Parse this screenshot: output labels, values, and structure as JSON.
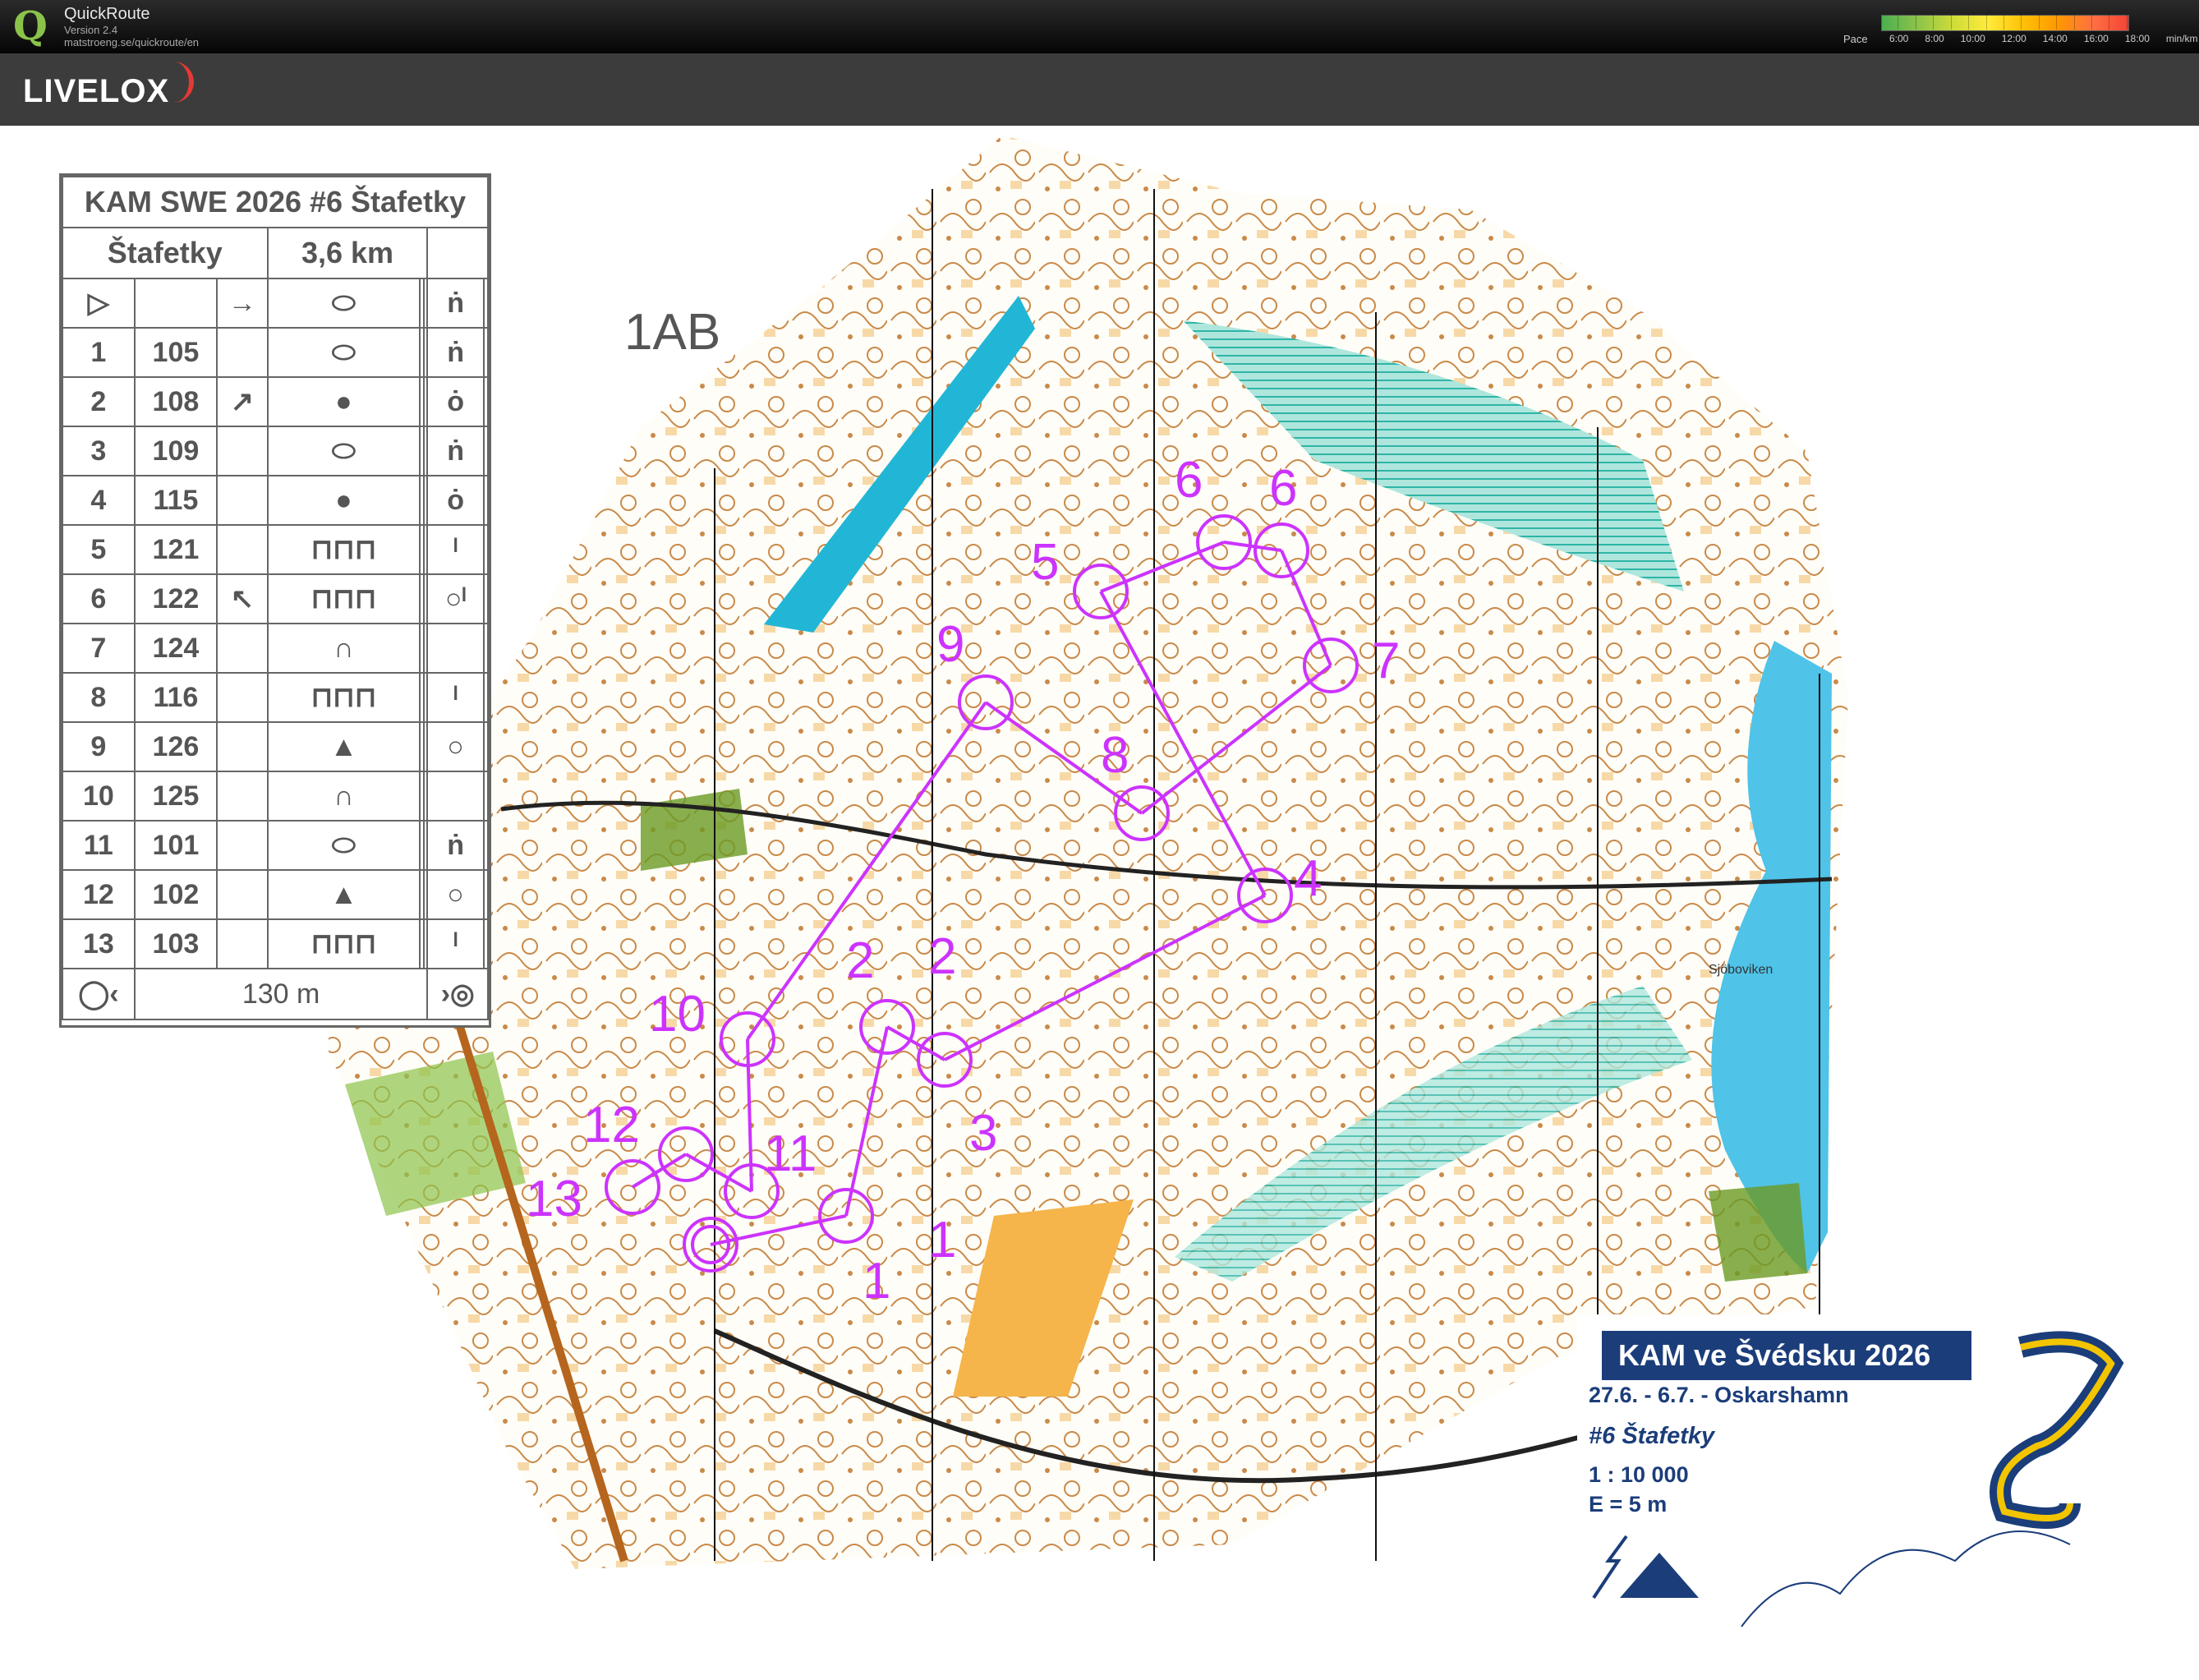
{
  "app": {
    "name": "QuickRoute",
    "version": "Version 2.4",
    "url": "matstroeng.se/quickroute/en",
    "logo_letter": "Q"
  },
  "pace_legend": {
    "label": "Pace",
    "values": [
      "6:00",
      "8:00",
      "10:00",
      "12:00",
      "14:00",
      "16:00",
      "18:00",
      "min/km"
    ]
  },
  "brand": {
    "name": "LIVELOX",
    "accent_color": "#e53935"
  },
  "map": {
    "overlay_label": "1AB",
    "place_name": "Sjöboviken",
    "course_color": "#cc33ff",
    "control_numbers": [
      "1",
      "1",
      "2",
      "2",
      "3",
      "4",
      "5",
      "6",
      "6",
      "7",
      "8",
      "9",
      "10",
      "11",
      "12",
      "13"
    ]
  },
  "control_descriptions": {
    "title": "KAM SWE 2026 #6 Štafetky",
    "class": "Štafetky",
    "length": "3,6 km",
    "start_symbols": [
      "▷",
      "",
      "→",
      "⬭",
      "",
      "",
      "ṅ"
    ],
    "rows": [
      {
        "num": "1",
        "code": "105",
        "dir": "",
        "feature": "⬭",
        "extra": "ṅ"
      },
      {
        "num": "2",
        "code": "108",
        "dir": "↗",
        "feature": "●",
        "extra": "ȯ"
      },
      {
        "num": "3",
        "code": "109",
        "dir": "",
        "feature": "⬭",
        "extra": "ṅ"
      },
      {
        "num": "4",
        "code": "115",
        "dir": "",
        "feature": "●",
        "extra": "ȯ"
      },
      {
        "num": "5",
        "code": "121",
        "dir": "",
        "feature": "⊓⊓⊓",
        "extra": "ˡ"
      },
      {
        "num": "6",
        "code": "122",
        "dir": "↖",
        "feature": "⊓⊓⊓",
        "extra": "○ˡ"
      },
      {
        "num": "7",
        "code": "124",
        "dir": "",
        "feature": "∩",
        "extra": ""
      },
      {
        "num": "8",
        "code": "116",
        "dir": "",
        "feature": "⊓⊓⊓",
        "extra": "ˡ"
      },
      {
        "num": "9",
        "code": "126",
        "dir": "",
        "feature": "▲",
        "extra": "○"
      },
      {
        "num": "10",
        "code": "125",
        "dir": "",
        "feature": "∩",
        "extra": ""
      },
      {
        "num": "11",
        "code": "101",
        "dir": "",
        "feature": "⬭",
        "extra": "ṅ"
      },
      {
        "num": "12",
        "code": "102",
        "dir": "",
        "feature": "▲",
        "extra": "○"
      },
      {
        "num": "13",
        "code": "103",
        "dir": "",
        "feature": "⊓⊓⊓",
        "extra": "ˡ"
      }
    ],
    "finish_distance": "130 m"
  },
  "event_info": {
    "title": "KAM ve Švédsku 2026",
    "dates": "27.6. - 6.7. - Oskarshamn",
    "event": "#6 Štafetky",
    "scale": "1 : 10 000",
    "equidistance": "E = 5 m"
  }
}
